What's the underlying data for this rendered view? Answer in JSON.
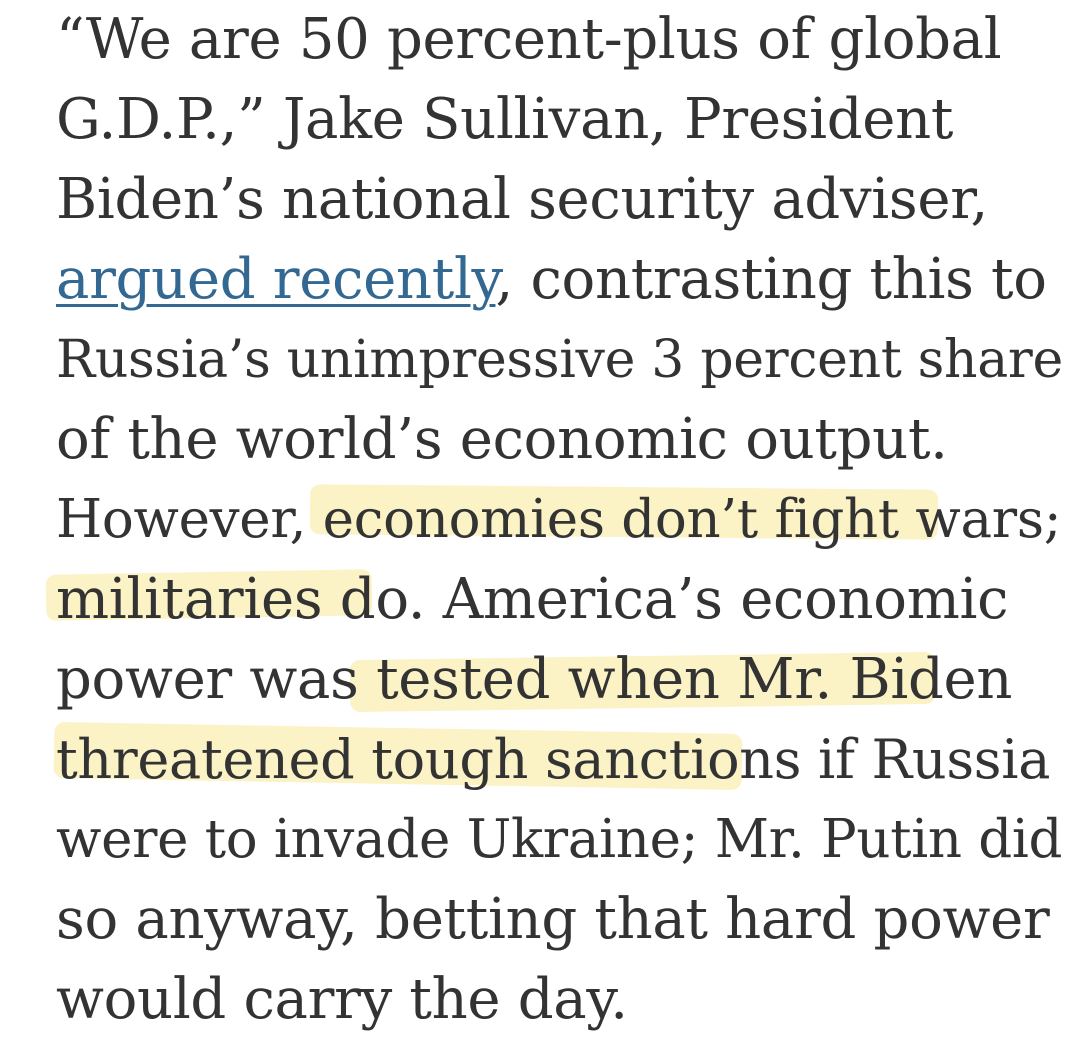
{
  "article": {
    "lines": [
      {
        "text": "“We are 50 percent-plus of global"
      },
      {
        "text": "G.D.P.,” Jake Sullivan, President"
      },
      {
        "text": "Biden’s national security adviser,"
      },
      {
        "link": "argued recently",
        "text": ", contrasting this to"
      },
      {
        "text": "Russia’s unimpressive 3 percent share"
      },
      {
        "text": "of the world’s economic output."
      },
      {
        "pre": "However, ec",
        "highlight": "onomies don’t fight war",
        "post": "s;"
      },
      {
        "highlight": "militaries do",
        "post": ". America’s economic"
      },
      {
        "pre": "power was te",
        "highlight": "sted when Mr. Biden",
        "post": ""
      },
      {
        "highlight": "threatened tough sanctions",
        "post": " if Russia"
      },
      {
        "text": "were to invade Ukraine; Mr. Putin did"
      },
      {
        "text": "so anyway, betting that hard power"
      },
      {
        "text": "would carry the day."
      }
    ],
    "highlight_color": "#f8e896",
    "link_color": "#326891",
    "text_color": "#333333"
  }
}
